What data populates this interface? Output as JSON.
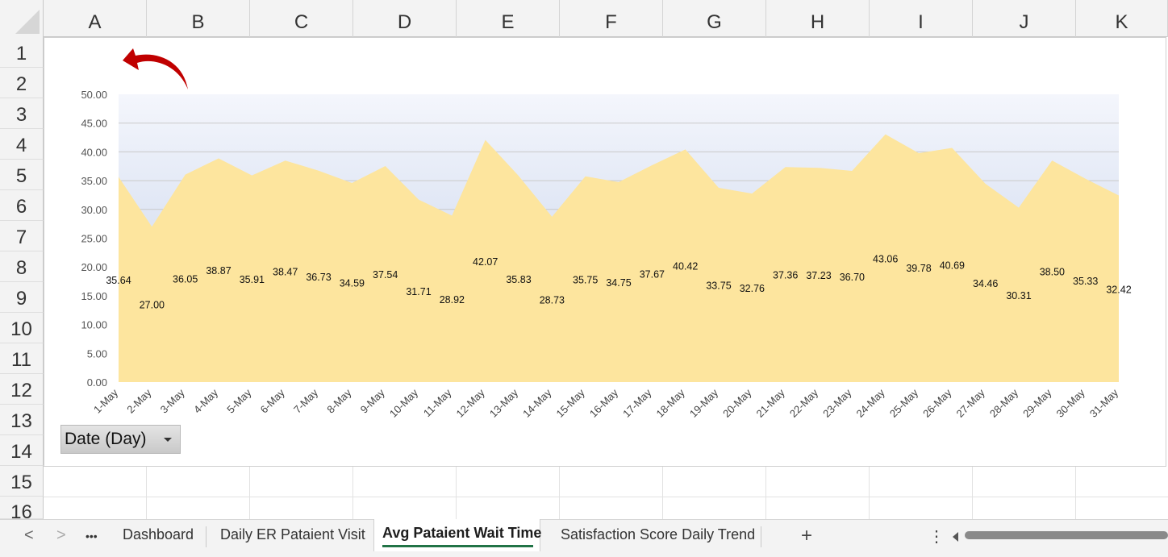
{
  "columns": [
    "A",
    "B",
    "C",
    "D",
    "E",
    "F",
    "G",
    "H",
    "I",
    "J",
    "K"
  ],
  "rows": [
    "1",
    "2",
    "3",
    "4",
    "5",
    "6",
    "7",
    "8",
    "9",
    "10",
    "11",
    "12",
    "13",
    "14",
    "15",
    "16"
  ],
  "chart_data": {
    "type": "area",
    "categories": [
      "1-May",
      "2-May",
      "3-May",
      "4-May",
      "5-May",
      "6-May",
      "7-May",
      "8-May",
      "9-May",
      "10-May",
      "11-May",
      "12-May",
      "13-May",
      "14-May",
      "15-May",
      "16-May",
      "17-May",
      "18-May",
      "19-May",
      "20-May",
      "21-May",
      "22-May",
      "23-May",
      "24-May",
      "25-May",
      "26-May",
      "27-May",
      "28-May",
      "29-May",
      "30-May",
      "31-May"
    ],
    "values": [
      35.64,
      27.0,
      36.05,
      38.87,
      35.91,
      38.47,
      36.73,
      34.59,
      37.54,
      31.71,
      28.92,
      42.07,
      35.83,
      28.73,
      35.75,
      34.75,
      37.67,
      40.42,
      33.75,
      32.76,
      37.36,
      37.23,
      36.7,
      43.06,
      39.78,
      40.69,
      34.46,
      30.31,
      38.5,
      35.33,
      32.42
    ],
    "value_labels": [
      "35.64",
      "27.00",
      "36.05",
      "38.87",
      "35.91",
      "38.47",
      "36.73",
      "34.59",
      "37.54",
      "31.71",
      "28.92",
      "42.07",
      "35.83",
      "28.73",
      "35.75",
      "34.75",
      "37.67",
      "40.42",
      "33.75",
      "32.76",
      "37.36",
      "37.23",
      "36.70",
      "43.06",
      "39.78",
      "40.69",
      "34.46",
      "30.31",
      "38.50",
      "35.33",
      "32.42"
    ],
    "y_ticks": [
      "0.00",
      "5.00",
      "10.00",
      "15.00",
      "20.00",
      "25.00",
      "30.00",
      "35.00",
      "40.00",
      "45.00",
      "50.00"
    ],
    "ylim": [
      0,
      50
    ],
    "title": "",
    "xlabel": "",
    "ylabel": "",
    "grid": true,
    "legend": "none",
    "area_color": "#fde59e",
    "plot_bg_top": "#f4f6fc",
    "plot_bg_bottom": "#c3d0ea",
    "back_arrow_icon": "curved-back-arrow-icon",
    "back_arrow_color": "#c00000"
  },
  "slicer": {
    "label": "Date (Day)"
  },
  "tabs": {
    "dashboard": "Dashboard",
    "er_visit": "Daily ER Pataient Visit",
    "wait_time": "Avg Pataient Wait Time",
    "satisfaction": "Satisfaction Score Daily Trend",
    "active": "Avg Pataient Wait Time",
    "prev": "<",
    "next": ">",
    "more": "•••",
    "add": "+",
    "options": "⋮"
  },
  "colors": {
    "active_tab_underline": "#217346"
  }
}
